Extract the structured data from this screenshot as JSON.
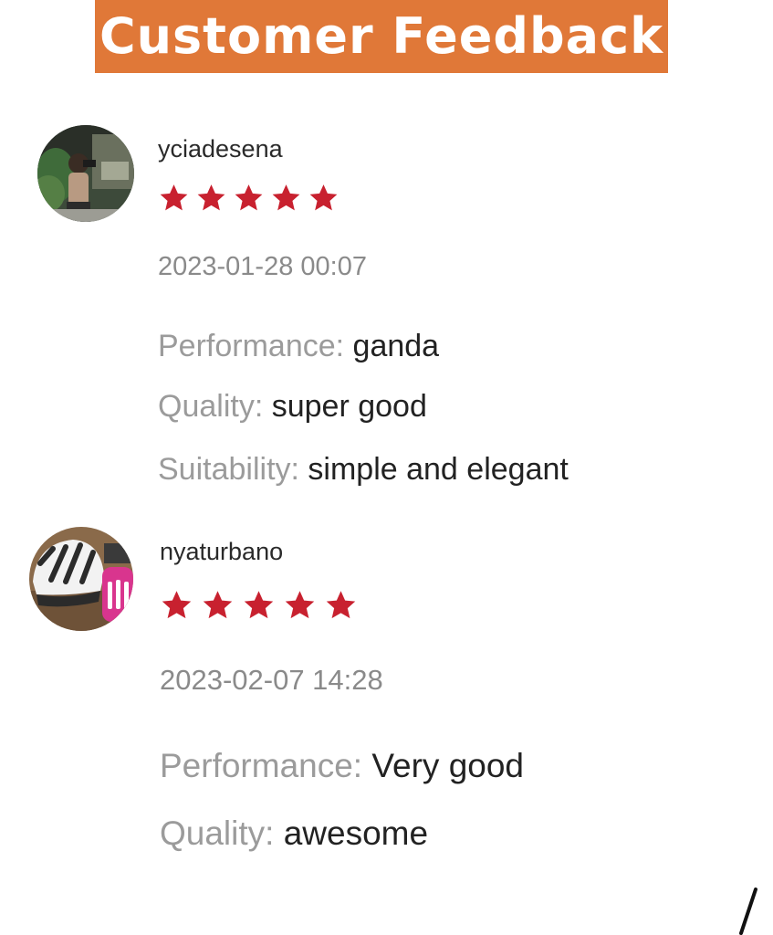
{
  "header": {
    "title": "Customer Feedback",
    "color": "#e07838"
  },
  "colors": {
    "star": "#c8212f",
    "label": "#9b9b9b",
    "value": "#222222"
  },
  "reviews": [
    {
      "username": "yciadesena",
      "rating": 5,
      "timestamp": "2023-01-28 00:07",
      "avatar_icon": "user-photo-avatar-icon",
      "attributes": [
        {
          "label": "Performance:",
          "value": "ganda"
        },
        {
          "label": "Quality:",
          "value": "super good"
        },
        {
          "label": "Suitability:",
          "value": "simple and elegant"
        }
      ]
    },
    {
      "username": "nyaturbano",
      "rating": 5,
      "timestamp": "2023-02-07 14:28",
      "avatar_icon": "helmet-photo-avatar-icon",
      "attributes": [
        {
          "label": "Performance:",
          "value": "Very good"
        },
        {
          "label": "Quality:",
          "value": "awesome"
        }
      ]
    }
  ]
}
